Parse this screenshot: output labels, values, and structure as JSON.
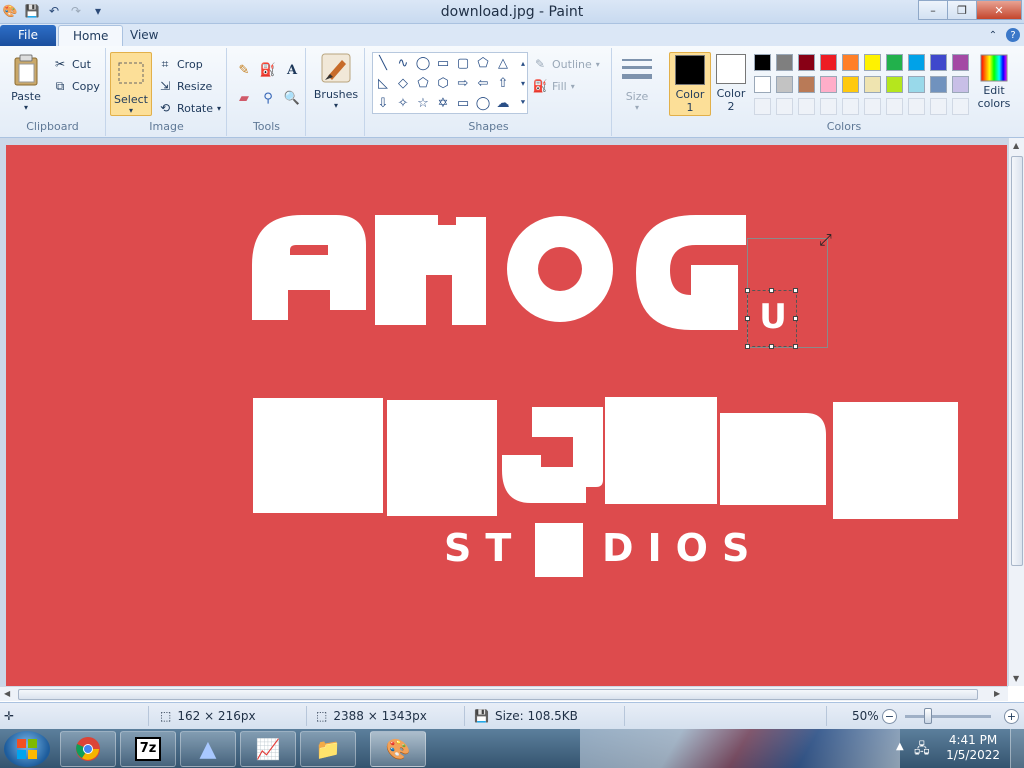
{
  "window": {
    "title": "download.jpg - Paint",
    "minimize": "–",
    "maximize": "❐",
    "close": "✕"
  },
  "tabs": {
    "file": "File",
    "home": "Home",
    "view": "View"
  },
  "ribbon": {
    "clipboard": {
      "label": "Clipboard",
      "paste": "Paste",
      "cut": "Cut",
      "copy": "Copy"
    },
    "image": {
      "label": "Image",
      "select": "Select",
      "crop": "Crop",
      "resize": "Resize",
      "rotate": "Rotate"
    },
    "tools": {
      "label": "Tools"
    },
    "brushes": {
      "label": "Brushes"
    },
    "shapes": {
      "label": "Shapes",
      "outline": "Outline",
      "fill": "Fill"
    },
    "size": {
      "label": "Size"
    },
    "colors": {
      "label": "Colors",
      "color1": "Color",
      "color1_num": "1",
      "color2": "Color",
      "color2_num": "2",
      "edit_colors": "Edit",
      "edit_colors_2": "colors",
      "color1_value": "#000000",
      "color2_value": "#ffffff",
      "palette_row1": [
        "#000000",
        "#7f7f7f",
        "#880015",
        "#ed1c24",
        "#ff7f27",
        "#fff200",
        "#22b14c",
        "#00a2e8",
        "#3f48cc",
        "#a349a4"
      ],
      "palette_row2": [
        "#ffffff",
        "#c3c3c3",
        "#b97a57",
        "#ffaec9",
        "#ffc90e",
        "#efe4b0",
        "#b5e61d",
        "#99d9ea",
        "#7092be",
        "#c8bfe7"
      ]
    }
  },
  "canvas": {
    "background": "#dd4b4d",
    "selection_letter": "U",
    "studios_left": "ST",
    "studios_right": "DIOS"
  },
  "status": {
    "selection_size": "162 × 216px",
    "image_size": "2388 × 1343px",
    "file_size": "Size: 108.5KB",
    "zoom": "50%"
  },
  "taskbar": {
    "time": "4:41 PM",
    "date": "1/5/2022"
  }
}
